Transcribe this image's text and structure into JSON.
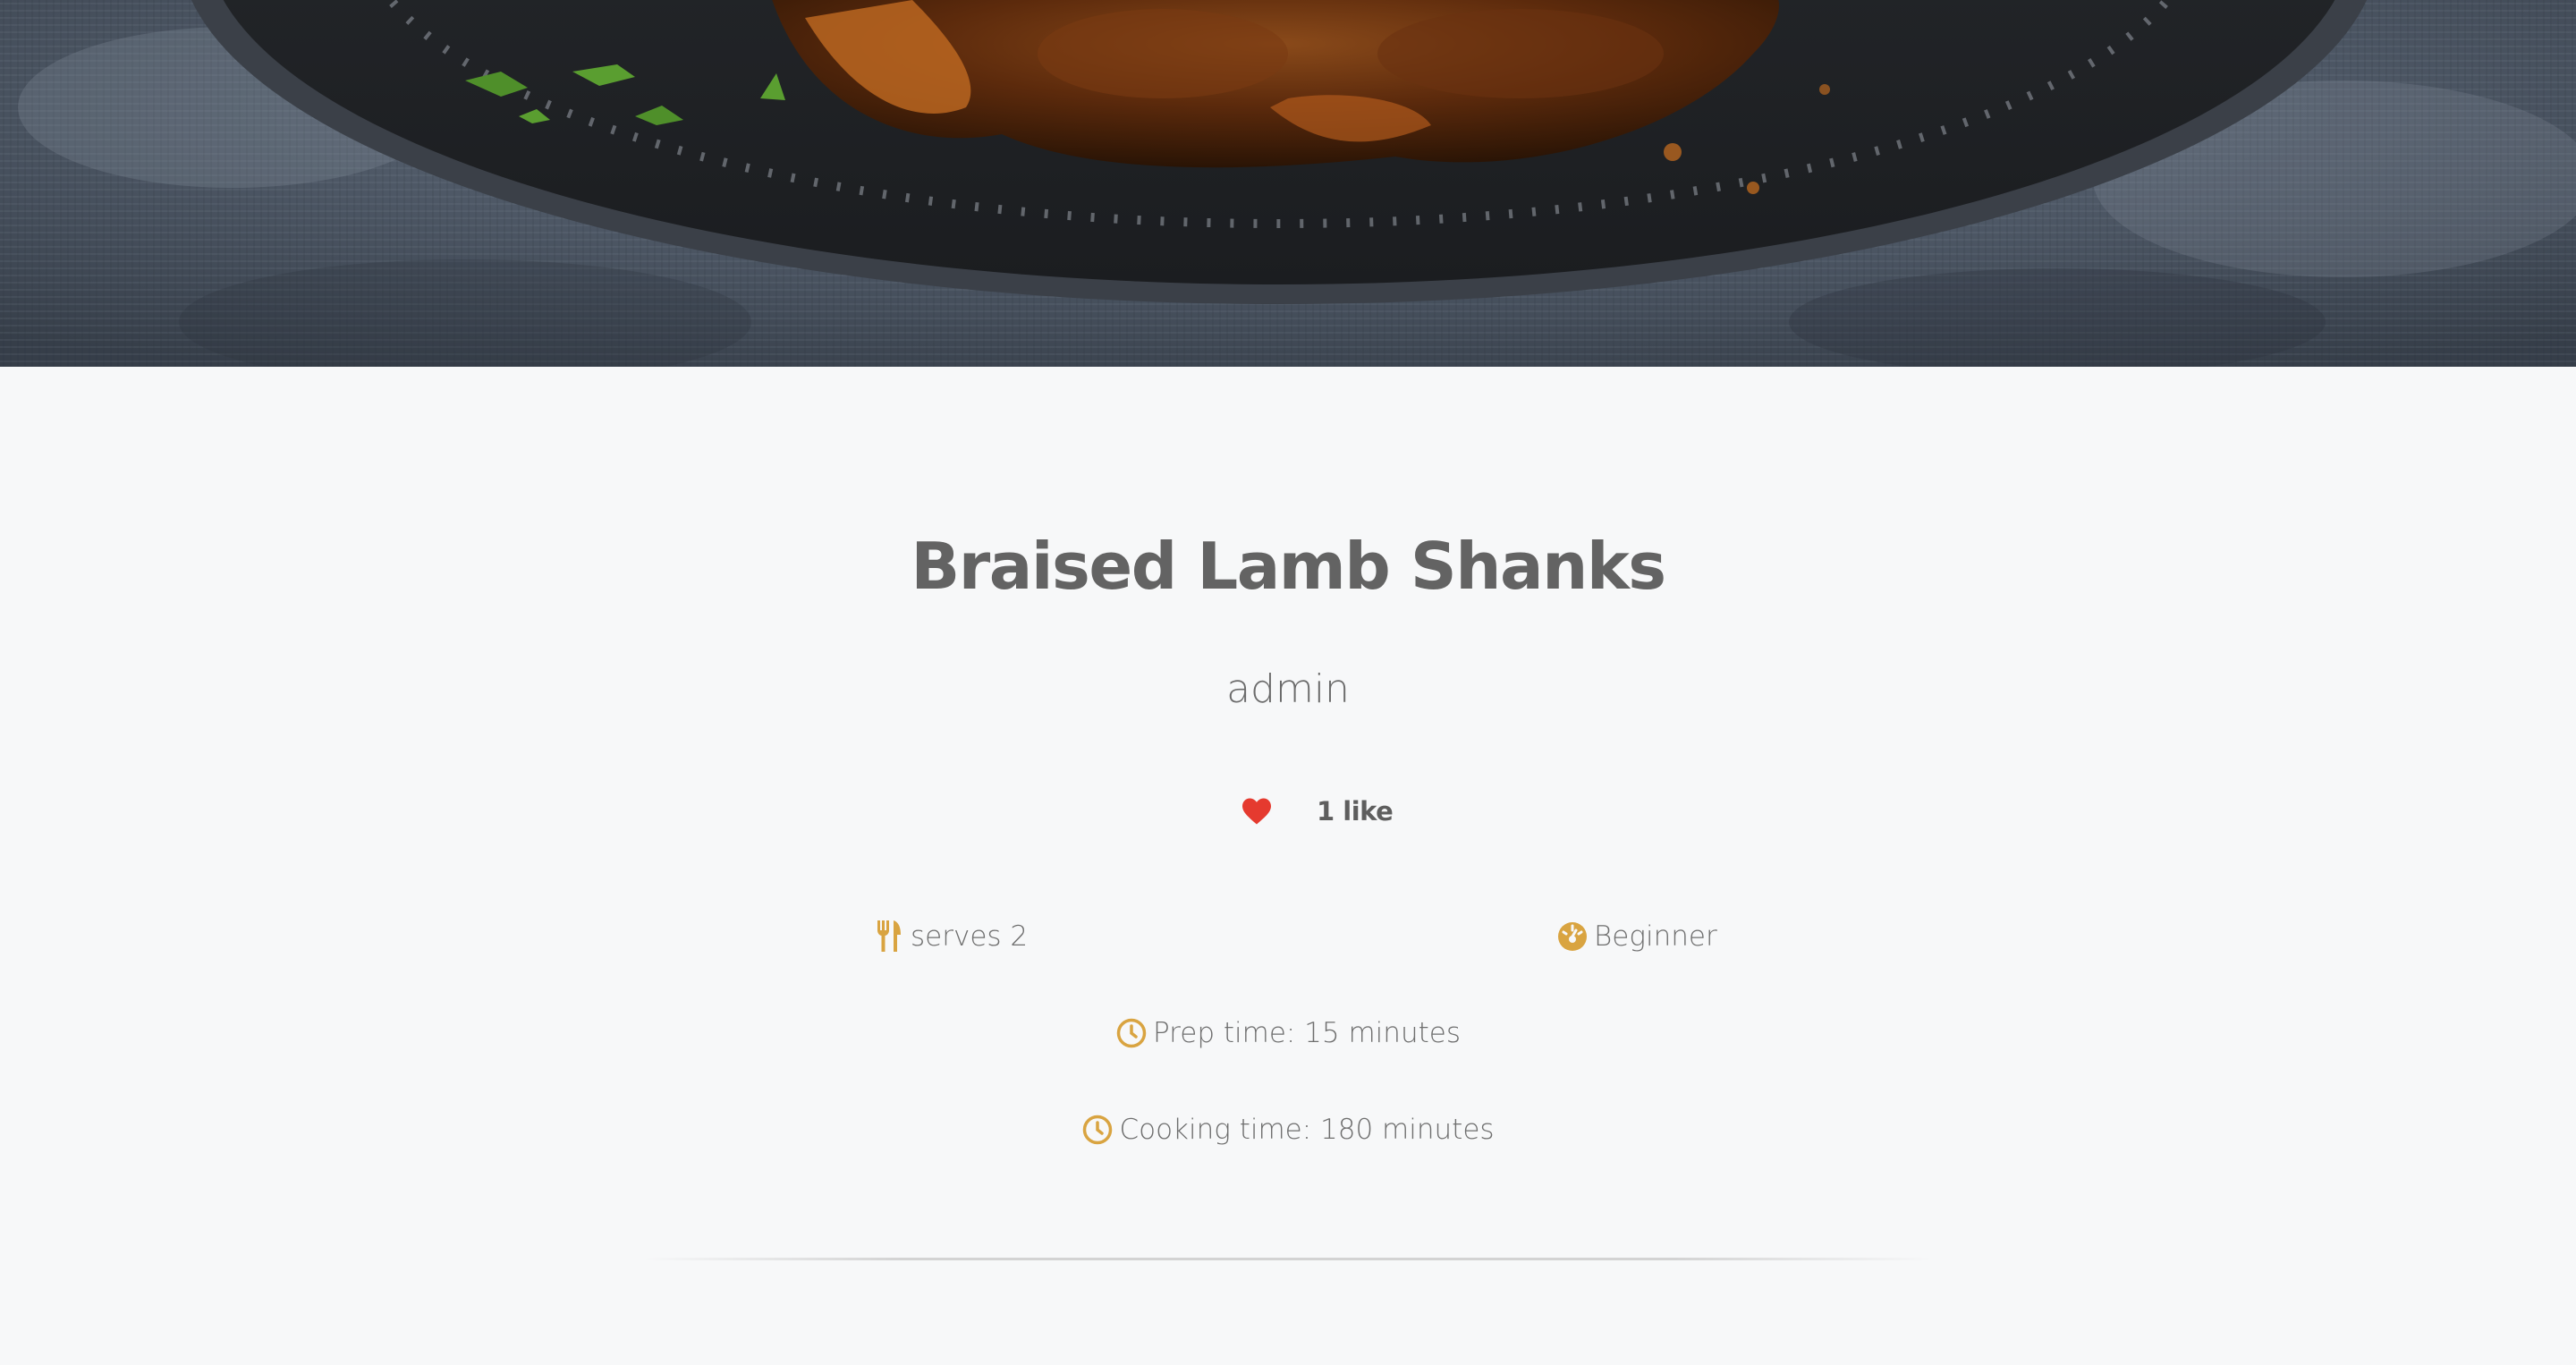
{
  "recipe": {
    "title": "Braised Lamb Shanks",
    "author": "admin",
    "likes_label": "1 like",
    "serves_label": "serves 2",
    "difficulty_label": "Beginner",
    "prep_label": "Prep time: 15 minutes",
    "cook_label": "Cooking time: 180 minutes"
  },
  "icons": {
    "like": "heart-icon",
    "serves": "utensils-icon",
    "difficulty": "gauge-icon",
    "prep": "clock-icon",
    "cook": "clock-icon"
  },
  "colors": {
    "heart": "#e53a2f",
    "accent_icon": "#d9a441",
    "title": "#636363",
    "text": "#6e6e6e",
    "background": "#f7f8f9"
  }
}
